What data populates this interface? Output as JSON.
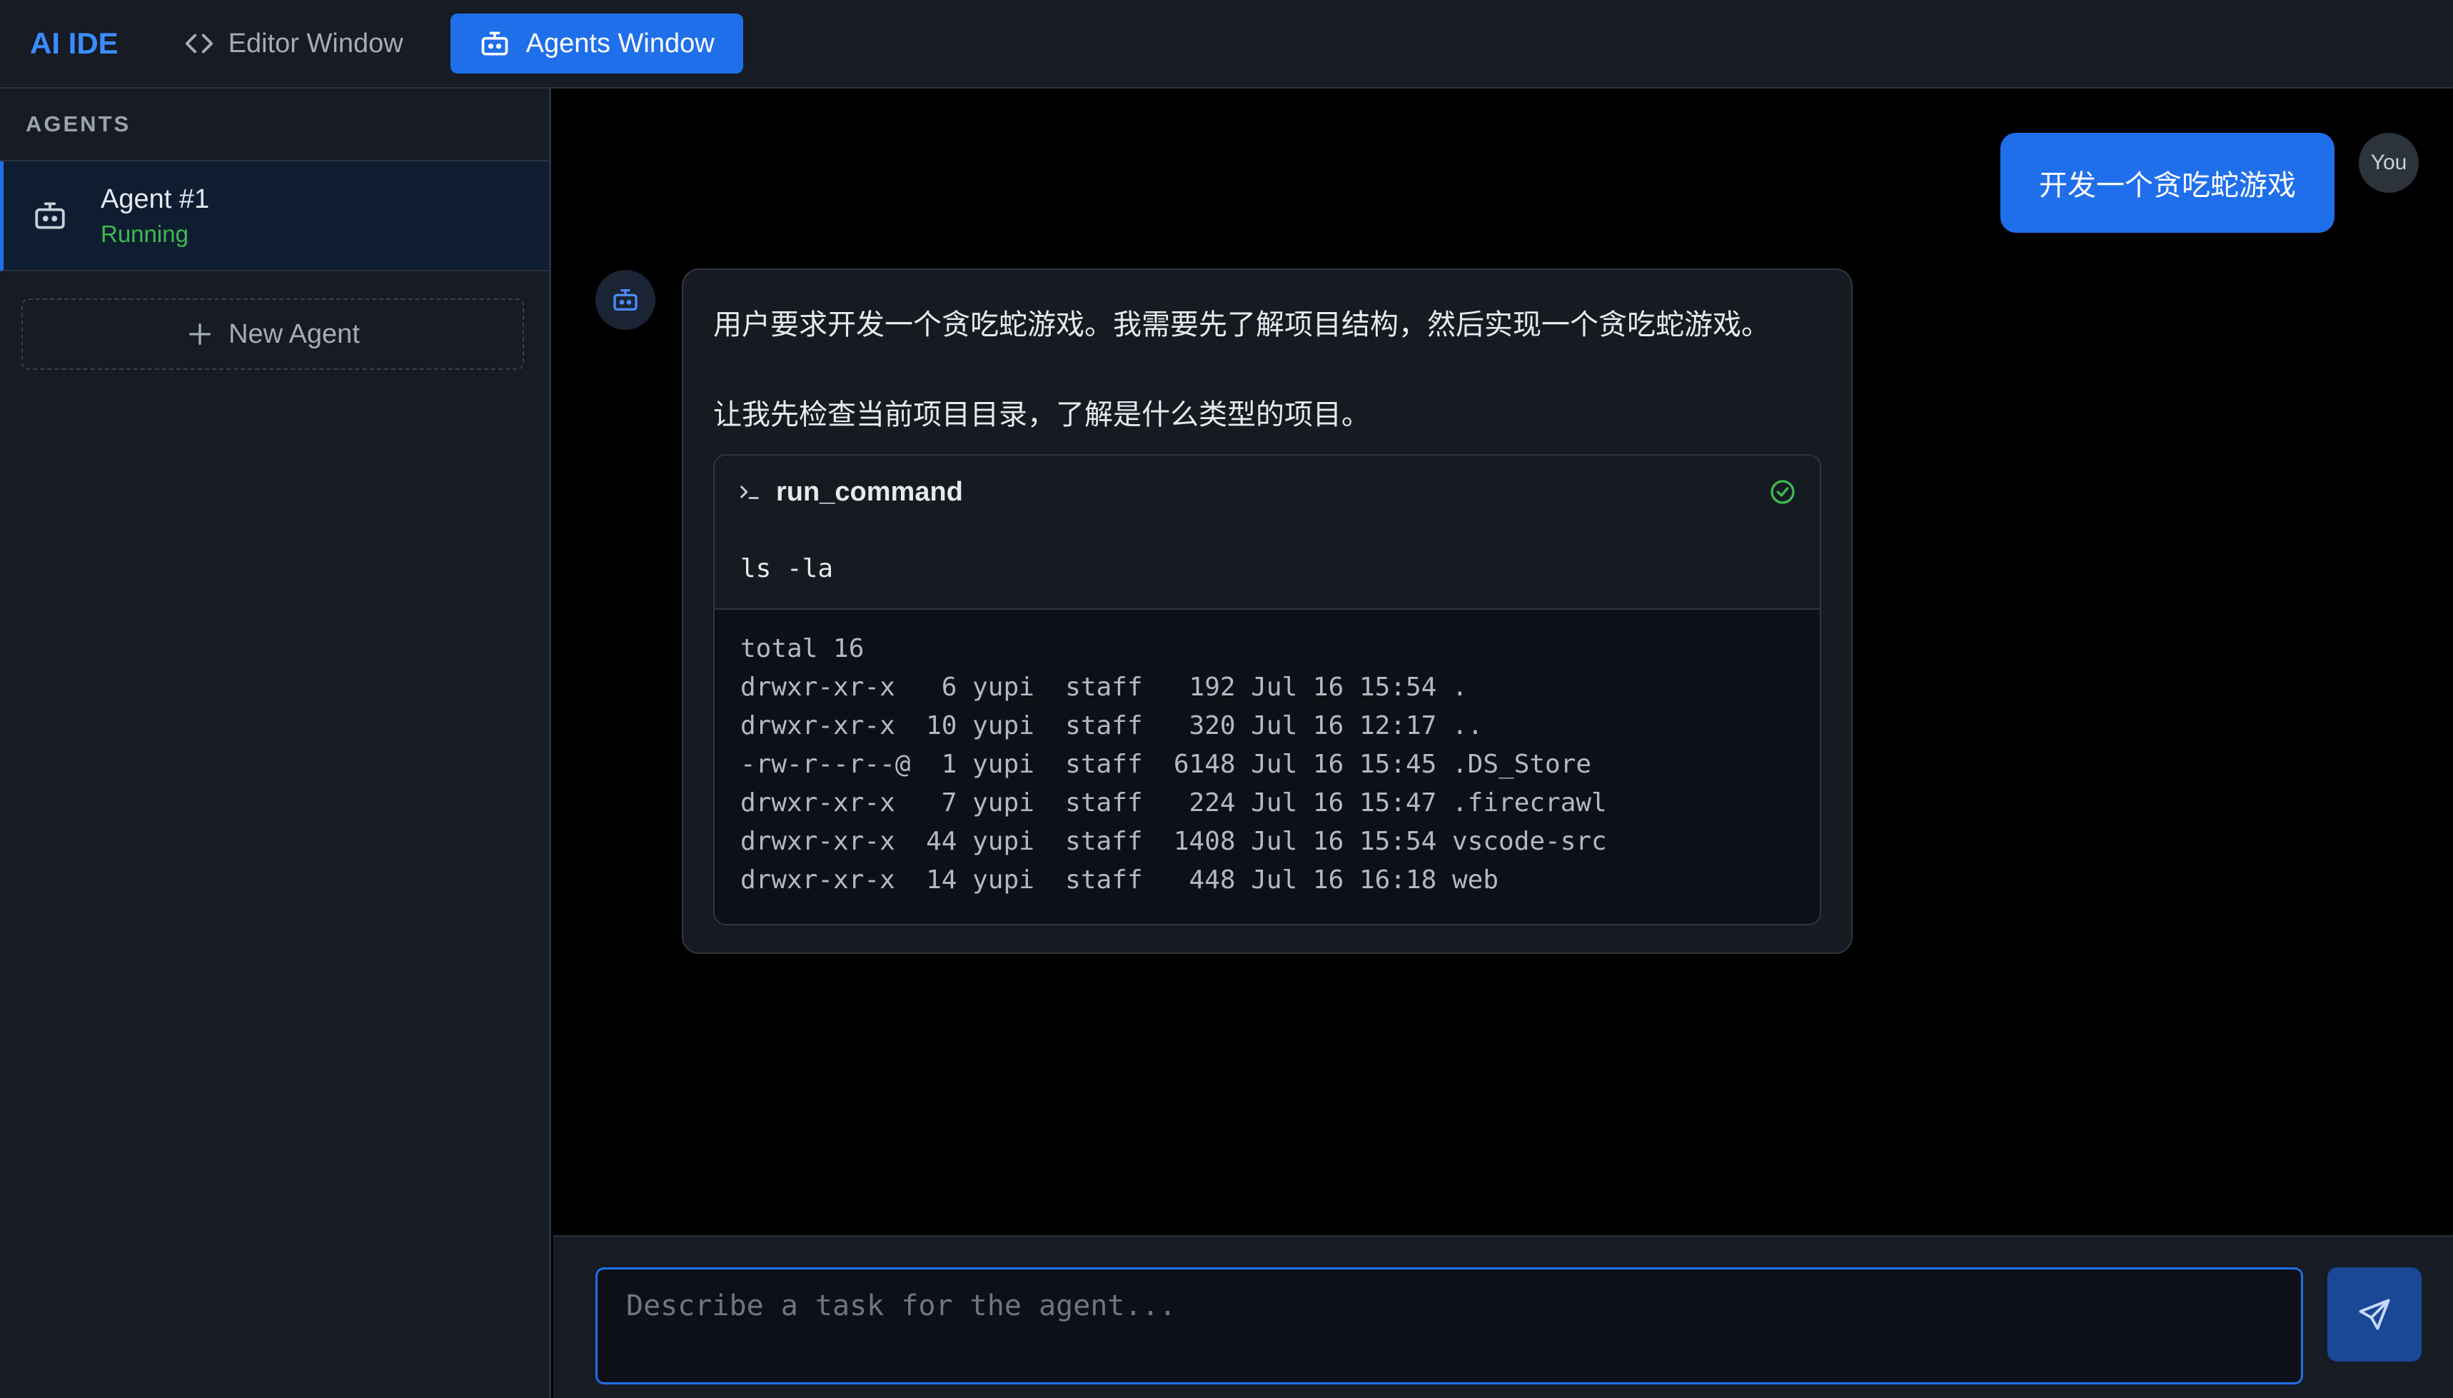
{
  "app": {
    "brand": "AI IDE",
    "tabs": [
      {
        "label": "Editor Window",
        "icon": "code-icon",
        "active": false
      },
      {
        "label": "Agents Window",
        "icon": "robot-icon",
        "active": true
      }
    ],
    "accent_color": "#1f6feb",
    "running_color": "#3fb950"
  },
  "sidebar": {
    "header": "AGENTS",
    "agents": [
      {
        "name": "Agent #1",
        "status": "Running",
        "icon": "robot-icon"
      }
    ],
    "new_agent_label": "New Agent"
  },
  "chat": {
    "user_message": "开发一个贪吃蛇游戏",
    "user_avatar": "You",
    "agent_paragraphs": [
      "用户要求开发一个贪吃蛇游戏。我需要先了解项目结构，然后实现一个贪吃蛇游戏。",
      "让我先检查当前项目目录，了解是什么类型的项目。"
    ],
    "tool_call": {
      "name": "run_command",
      "icon": "terminal-icon",
      "status_icon": "check-circle-icon",
      "command": "ls -la",
      "output_lines": [
        "total 16",
        "drwxr-xr-x   6 yupi  staff   192 Jul 16 15:54 .",
        "drwxr-xr-x  10 yupi  staff   320 Jul 16 12:17 ..",
        "-rw-r--r--@  1 yupi  staff  6148 Jul 16 15:45 .DS_Store",
        "drwxr-xr-x   7 yupi  staff   224 Jul 16 15:47 .firecrawl",
        "drwxr-xr-x  44 yupi  staff  1408 Jul 16 15:54 vscode-src",
        "drwxr-xr-x  14 yupi  staff   448 Jul 16 16:18 web"
      ]
    }
  },
  "composer": {
    "placeholder": "Describe a task for the agent...",
    "value": "",
    "send_icon": "send-icon"
  }
}
